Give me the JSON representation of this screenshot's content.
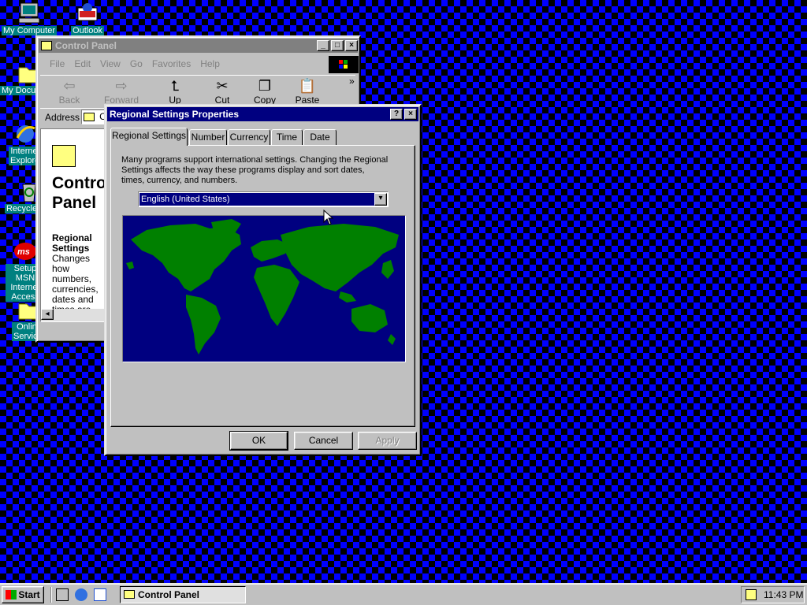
{
  "desktop": {
    "icons": [
      {
        "label": "My Computer"
      },
      {
        "label": "Outlook"
      },
      {
        "label": "My Documents"
      },
      {
        "label": "Internet Explorer"
      },
      {
        "label": "Recycle Bin"
      },
      {
        "label": "Setup MSN Internet Access"
      },
      {
        "label": "Online Services"
      }
    ],
    "colors": {
      "checker_a": "#0000ff",
      "checker_b": "#000000",
      "icon_label_bg": "#008080"
    }
  },
  "control_panel": {
    "title": "Control Panel",
    "menu": [
      "File",
      "Edit",
      "View",
      "Go",
      "Favorites",
      "Help"
    ],
    "toolbar": [
      {
        "label": "Back",
        "icon": "back-arrow-icon",
        "enabled": false
      },
      {
        "label": "Forward",
        "icon": "forward-arrow-icon",
        "enabled": false
      },
      {
        "label": "Up",
        "icon": "up-folder-icon",
        "enabled": true
      },
      {
        "label": "Cut",
        "icon": "scissors-icon",
        "enabled": true
      },
      {
        "label": "Copy",
        "icon": "copy-icon",
        "enabled": true
      },
      {
        "label": "Paste",
        "icon": "paste-icon",
        "enabled": true
      }
    ],
    "chevron": "»",
    "address_label": "Address",
    "address_value": "C",
    "heading": "Control Panel",
    "sidebar_title": "Regional Settings",
    "sidebar_text": "Changes how numbers, currencies, dates and times are"
  },
  "dialog": {
    "title": "Regional Settings Properties",
    "tabs": [
      "Regional Settings",
      "Number",
      "Currency",
      "Time",
      "Date"
    ],
    "active_tab": "Regional Settings",
    "description": "Many programs support international settings. Changing the Regional Settings affects the way these programs display and sort dates, times, currency, and numbers.",
    "locale_selected": "English (United States)",
    "map_colors": {
      "ocean": "#000080",
      "land": "#008000"
    },
    "buttons": {
      "ok": "OK",
      "cancel": "Cancel",
      "apply": "Apply"
    }
  },
  "taskbar": {
    "start_label": "Start",
    "tasks": [
      {
        "label": "Control Panel"
      }
    ],
    "clock": "11:43 PM"
  }
}
